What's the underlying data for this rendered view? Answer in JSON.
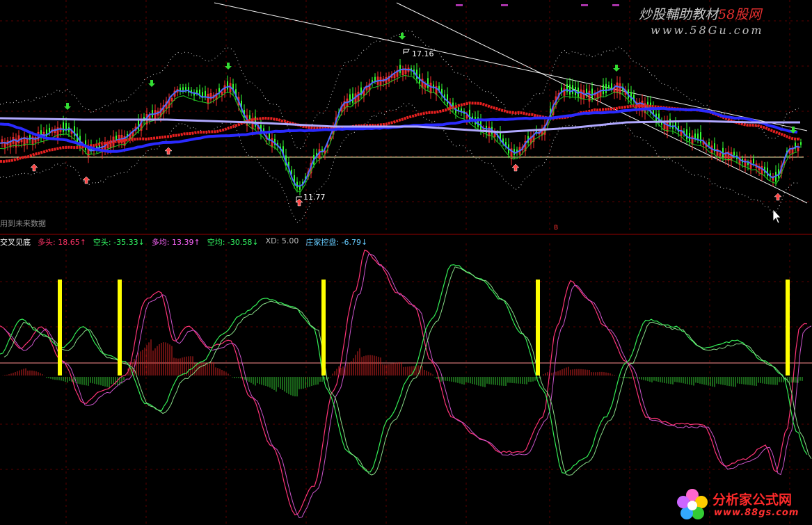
{
  "watermark": {
    "title_part1": "炒股輔助教材",
    "title_part2": "58股网",
    "url": "www.58Gu.com"
  },
  "price_panel": {
    "note": "用到未来数据",
    "high_label": "17.16",
    "low_label": "11.77",
    "marker_b": "B"
  },
  "indicator_legend": {
    "name": "交叉见底",
    "items": [
      {
        "label": "多头: 18.65",
        "arrow": "↑",
        "color": "#ff3366"
      },
      {
        "label": "空头: -35.33",
        "arrow": "↓",
        "color": "#33ff66"
      },
      {
        "label": "多均: 13.39",
        "arrow": "↑",
        "color": "#ff66ff"
      },
      {
        "label": "空均: -30.58",
        "arrow": "↓",
        "color": "#33ff66"
      },
      {
        "label": "XD: 5.00",
        "arrow": "",
        "color": "#bbbbbb"
      },
      {
        "label": "庄家控盘: -6.79",
        "arrow": "↓",
        "color": "#66ccff"
      }
    ]
  },
  "logo": {
    "title": "分析家公式网",
    "url": "www.88gs.com"
  },
  "colors": {
    "background": "#000000",
    "grid": "#5a0000",
    "up": "#ff3030",
    "down": "#33ff33",
    "ma_red": "#e82020",
    "ma_blue": "#2a2aff",
    "ma_lavender": "#b0a8ff",
    "signal_bar": "#ffff00"
  },
  "icons": {
    "buy_arrow": "up-arrow-icon",
    "sell_arrow": "down-arrow-icon",
    "cursor": "mouse-cursor-icon"
  }
}
